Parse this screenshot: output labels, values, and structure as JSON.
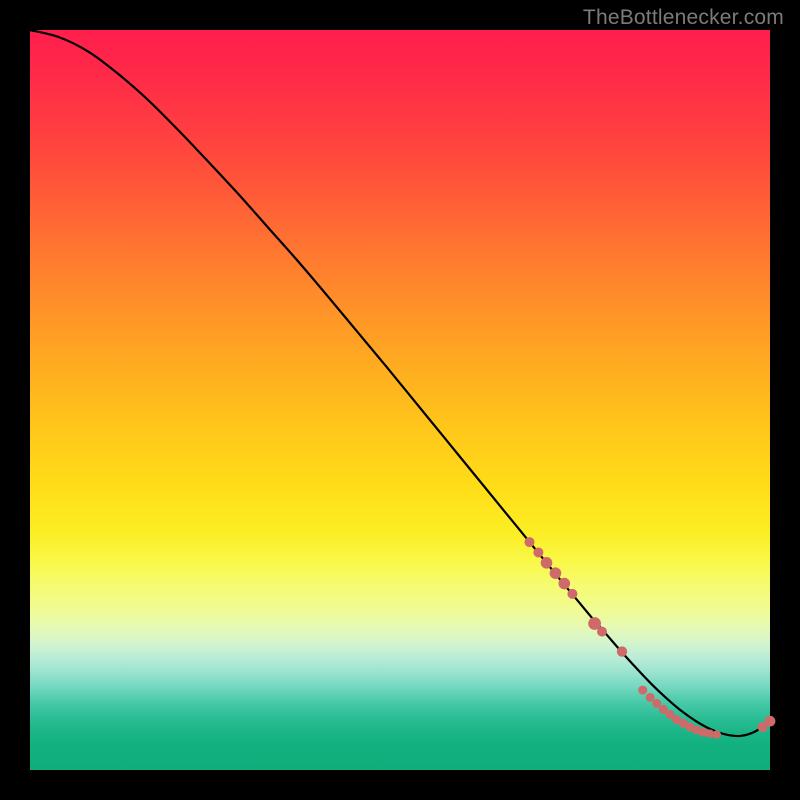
{
  "attribution": "TheBottlenecker.com",
  "colors": {
    "curve_stroke": "#000000",
    "marker_fill": "#CE6A69",
    "background_black": "#000000"
  },
  "chart_data": {
    "type": "line",
    "title": "",
    "xlabel": "",
    "ylabel": "",
    "xlim": [
      0,
      100
    ],
    "ylim": [
      0,
      100
    ],
    "series": [
      {
        "name": "bottleneck-curve",
        "x": [
          0,
          4,
          8,
          12,
          16,
          20,
          24,
          28,
          32,
          36,
          40,
          44,
          48,
          52,
          56,
          60,
          64,
          68,
          72,
          74,
          76,
          78,
          80,
          82,
          84,
          86,
          88,
          90,
          92,
          94,
          96,
          98,
          100
        ],
        "y": [
          100,
          99,
          97,
          94,
          90.5,
          86.5,
          82.3,
          78,
          73.5,
          69,
          64.3,
          59.5,
          54.7,
          49.8,
          44.9,
          40,
          35.1,
          30.2,
          25.3,
          22.9,
          20.5,
          18.2,
          15.9,
          13.7,
          11.6,
          9.7,
          8.0,
          6.6,
          5.5,
          4.8,
          4.6,
          5.2,
          6.6
        ]
      }
    ],
    "markers": [
      {
        "x": 67.5,
        "y": 30.8,
        "r": 5.0
      },
      {
        "x": 68.7,
        "y": 29.4,
        "r": 5.0
      },
      {
        "x": 69.8,
        "y": 28.0,
        "r": 5.8
      },
      {
        "x": 71.0,
        "y": 26.6,
        "r": 5.8
      },
      {
        "x": 72.2,
        "y": 25.2,
        "r": 5.8
      },
      {
        "x": 73.3,
        "y": 23.8,
        "r": 5.0
      },
      {
        "x": 76.3,
        "y": 19.8,
        "r": 6.4
      },
      {
        "x": 77.3,
        "y": 18.7,
        "r": 5.0
      },
      {
        "x": 80.0,
        "y": 16.0,
        "r": 5.2
      },
      {
        "x": 82.8,
        "y": 10.8,
        "r": 4.5
      },
      {
        "x": 83.8,
        "y": 9.8,
        "r": 4.5
      },
      {
        "x": 84.7,
        "y": 9.0,
        "r": 4.5
      },
      {
        "x": 85.6,
        "y": 8.2,
        "r": 4.5
      },
      {
        "x": 86.5,
        "y": 7.5,
        "r": 4.5
      },
      {
        "x": 87.4,
        "y": 6.8,
        "r": 4.5
      },
      {
        "x": 88.3,
        "y": 6.3,
        "r": 4.5
      },
      {
        "x": 89.2,
        "y": 5.8,
        "r": 4.5
      },
      {
        "x": 90.1,
        "y": 5.4,
        "r": 4.5
      },
      {
        "x": 91.0,
        "y": 5.1,
        "r": 4.5
      },
      {
        "x": 91.9,
        "y": 4.9,
        "r": 4.2
      },
      {
        "x": 92.8,
        "y": 4.8,
        "r": 4.2
      },
      {
        "x": 99.0,
        "y": 5.8,
        "r": 5.0
      },
      {
        "x": 100.0,
        "y": 6.6,
        "r": 5.4
      }
    ]
  }
}
